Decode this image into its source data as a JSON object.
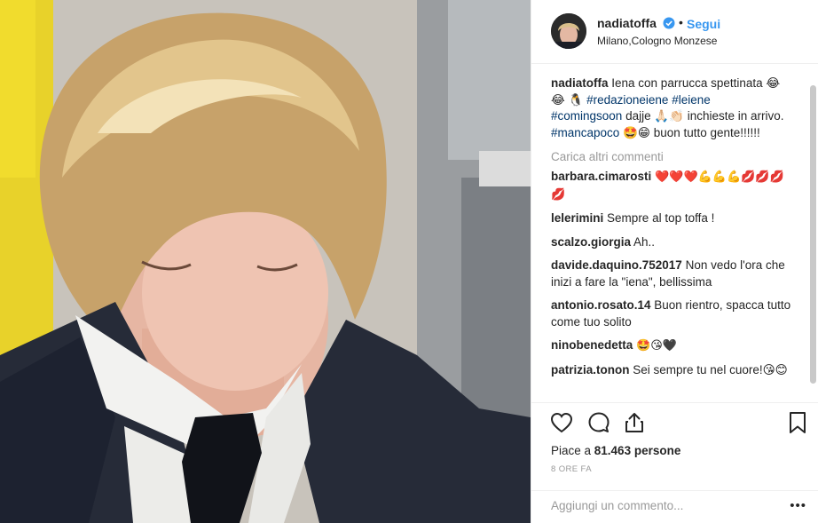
{
  "header": {
    "username": "nadiatoffa",
    "separator": "•",
    "follow_label": "Segui",
    "location": "Milano,Cologno Monzese"
  },
  "caption": {
    "username": "nadiatoffa",
    "text_a": " Iena con parrucca spettinata 😂",
    "text_b": "😂 🐧 ",
    "tag1": "#redazioneiene",
    "tag2": "#leiene",
    "tag3": "#comingsoon",
    "text_c": " dajje 🙏🏻👏🏻 inchieste in arrivo. ",
    "tag4": "#mancapoco",
    "text_d": " 🤩😁 buon tutto gente!!!!!!"
  },
  "load_more": "Carica altri commenti",
  "comments": [
    {
      "user": "barbara.cimarosti",
      "text": "❤️❤️❤️💪💪💪💋💋💋💋"
    },
    {
      "user": "lelerimini",
      "text": "Sempre al top toffa !"
    },
    {
      "user": "scalzo.giorgia",
      "text": "Ah.."
    },
    {
      "user": "davide.daquino.752017",
      "text": "Non vedo l'ora che inizi a fare la \"iena\", bellissima"
    },
    {
      "user": "antonio.rosato.14",
      "text": "Buon rientro, spacca tutto come tuo solito"
    },
    {
      "user": "ninobenedetta",
      "text": "🤩😘🖤"
    },
    {
      "user": "patrizia.tonon",
      "text": "Sei sempre tu nel cuore!😘😊"
    }
  ],
  "likes": {
    "prefix": "Piace a ",
    "count": "81.463",
    "suffix": " persone"
  },
  "timestamp": "8 ORE FA",
  "add_comment_placeholder": "Aggiungi un commento...",
  "more_label": "•••",
  "icons": [
    "heart-icon",
    "comment-icon",
    "share-icon",
    "bookmark-icon",
    "verified-icon"
  ],
  "colors": {
    "link": "#3897f0",
    "hashtag": "#003569",
    "muted": "#999999",
    "text": "#262626"
  }
}
